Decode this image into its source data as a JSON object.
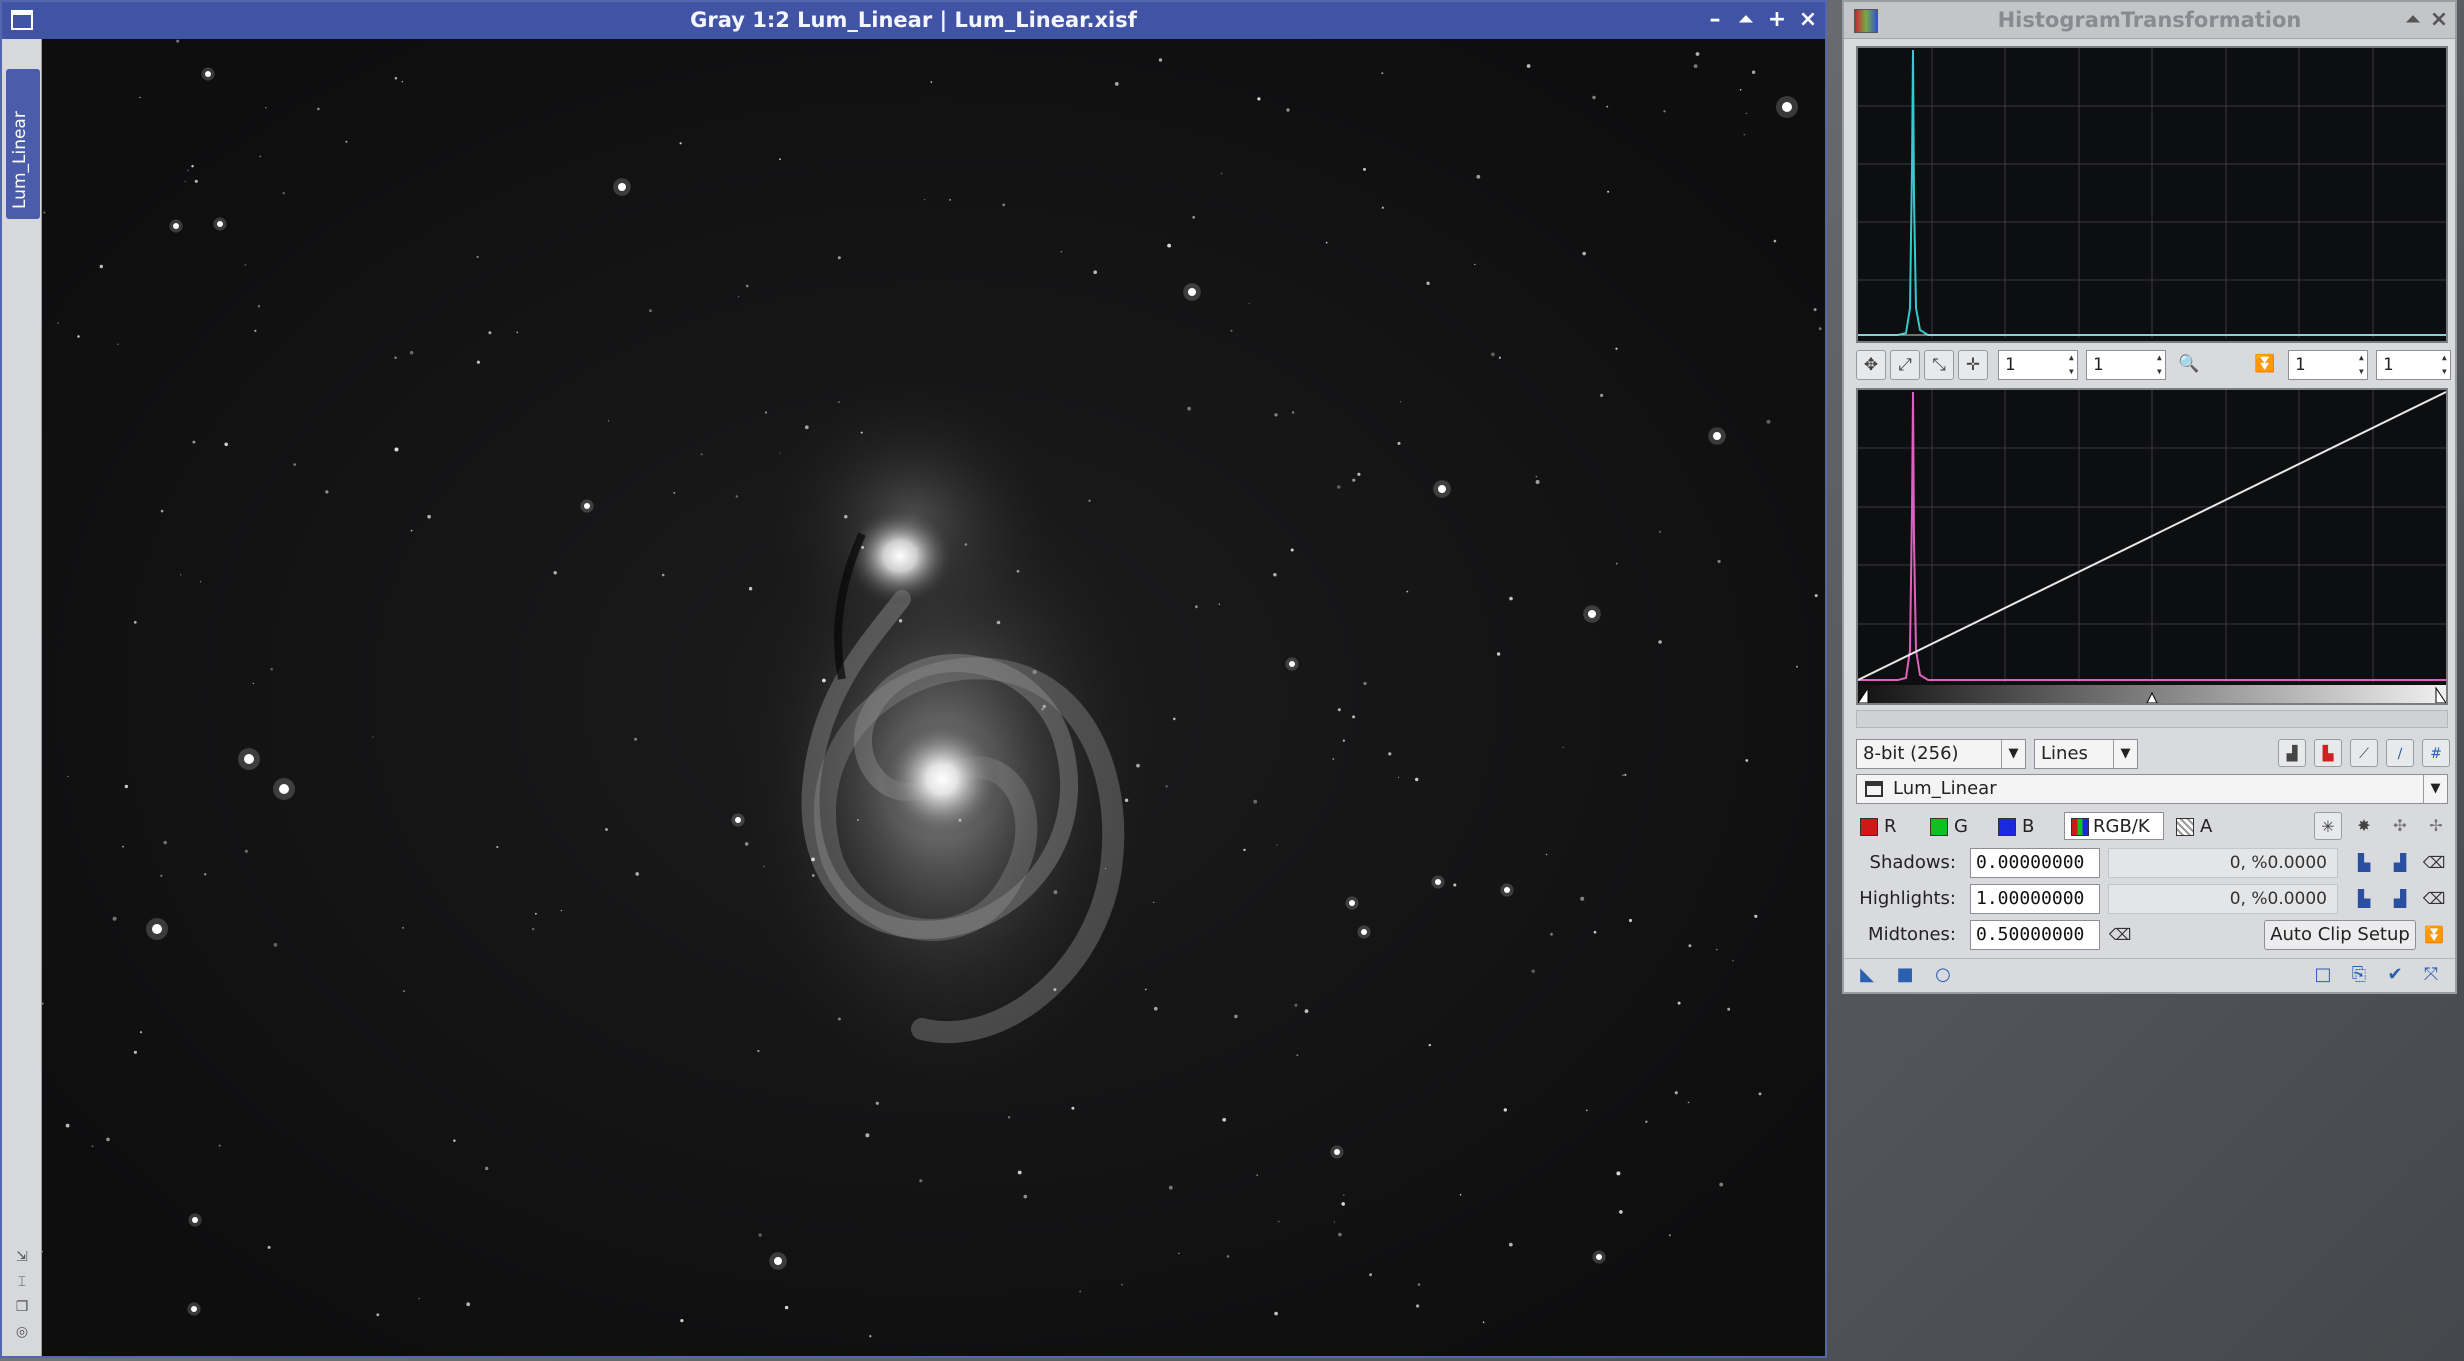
{
  "image_window": {
    "title": "Gray 1:2 Lum_Linear | Lum_Linear.xisf",
    "side_tab_label": "Lum_Linear",
    "buttons": {
      "minimize": "–",
      "shade": "⏶",
      "maximize": "+",
      "close": "×"
    }
  },
  "histogram": {
    "title": "HistogramTransformation",
    "zoom_fields": [
      "1",
      "1",
      "1",
      "1"
    ],
    "resolution": "8-bit (256)",
    "graph_style": "Lines",
    "view_selection": "Lum_Linear",
    "channels": {
      "r": "R",
      "g": "G",
      "b": "B",
      "rgbk": "RGB/K",
      "a": "A"
    },
    "colors": {
      "r": "#d01818",
      "g": "#10c020",
      "b": "#1a28e0"
    },
    "shadows": {
      "label": "Shadows:",
      "value": "0.00000000",
      "clipped": "0, %0.0000"
    },
    "highlights": {
      "label": "Highlights:",
      "value": "1.00000000",
      "clipped": "0, %0.0000"
    },
    "midtones": {
      "label": "Midtones:",
      "value": "0.50000000"
    },
    "auto_clip_label": "Auto Clip Setup"
  }
}
